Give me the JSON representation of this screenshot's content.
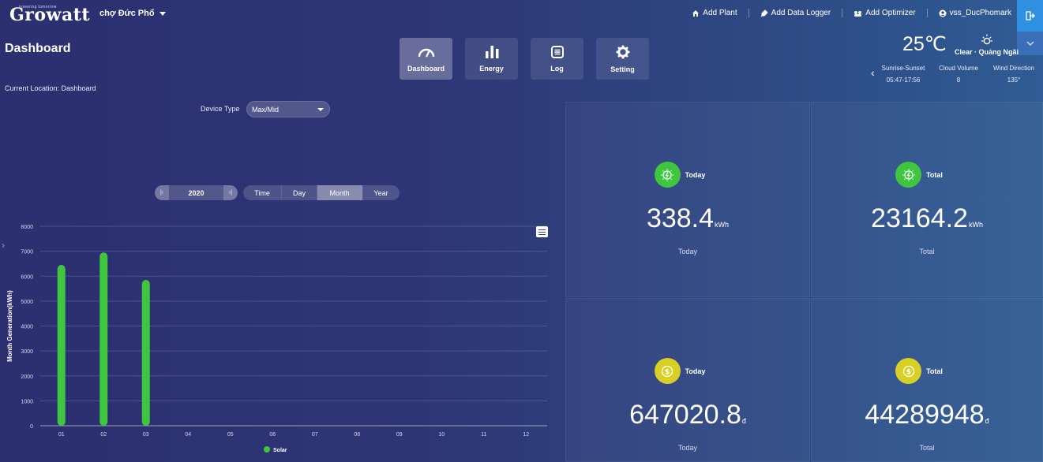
{
  "header": {
    "logo": "Growatt",
    "logo_tagline": "powering tomorrow",
    "plant_name": "chợ Đức Phổ",
    "nav": [
      {
        "label": "Add Plant",
        "icon": "home-icon"
      },
      {
        "label": "Add Data Logger",
        "icon": "plug-icon"
      },
      {
        "label": "Add Optimizer",
        "icon": "optimizer-icon"
      },
      {
        "label": "vss_DucPhomark",
        "icon": "user-icon"
      }
    ]
  },
  "page": {
    "title": "Dashboard",
    "location": "Current Location: Dashboard"
  },
  "tabs": [
    {
      "label": "Dashboard",
      "icon": "gauge-icon",
      "active": true
    },
    {
      "label": "Energy",
      "icon": "bar-chart-icon",
      "active": false
    },
    {
      "label": "Log",
      "icon": "log-icon",
      "active": false
    },
    {
      "label": "Setting",
      "icon": "gear-icon",
      "active": false
    }
  ],
  "weather": {
    "temperature": "25℃",
    "condition": "Clear · Quảng Ngãi",
    "stats": [
      {
        "label": "Sunrise-Sunset",
        "value": "05:47-17:56"
      },
      {
        "label": "Cloud Volume",
        "value": "8"
      },
      {
        "label": "Wind Direction",
        "value": "135°"
      }
    ]
  },
  "filters": {
    "device_label": "Device Type",
    "device_value": "Max/Mid",
    "year": "2020",
    "periods": [
      {
        "label": "Time",
        "active": false
      },
      {
        "label": "Day",
        "active": false
      },
      {
        "label": "Month",
        "active": true
      },
      {
        "label": "Year",
        "active": false
      }
    ]
  },
  "chart_data": {
    "type": "bar",
    "categories": [
      "01",
      "02",
      "03",
      "04",
      "05",
      "06",
      "07",
      "08",
      "09",
      "10",
      "11",
      "12"
    ],
    "series": [
      {
        "name": "Solar",
        "values": [
          6450,
          6950,
          5850,
          0,
          0,
          0,
          0,
          0,
          0,
          0,
          0,
          0
        ],
        "color": "#3ec63e"
      }
    ],
    "ylabel": "Month Generation(kWh)",
    "yticks": [
      "0",
      "1000",
      "2000",
      "3000",
      "4000",
      "5000",
      "6000",
      "7000",
      "8000"
    ],
    "ylim": [
      0,
      8000
    ],
    "grid": true,
    "legend": "bottom"
  },
  "stats": [
    {
      "title": "Today",
      "value": "338.4",
      "unit": "kWh",
      "sub": "Today",
      "kind": "energy"
    },
    {
      "title": "Total",
      "value": "23164.2",
      "unit": "kWh",
      "sub": "Total",
      "kind": "energy"
    },
    {
      "title": "Today",
      "value": "647020.8",
      "unit": "đ",
      "sub": "Today",
      "kind": "money"
    },
    {
      "title": "Total",
      "value": "44289948",
      "unit": "đ",
      "sub": "Total",
      "kind": "money"
    }
  ],
  "colors": {
    "energy_badge": "#3ec63e",
    "money_badge": "#d8d024",
    "accent": "#2f8fe0"
  }
}
